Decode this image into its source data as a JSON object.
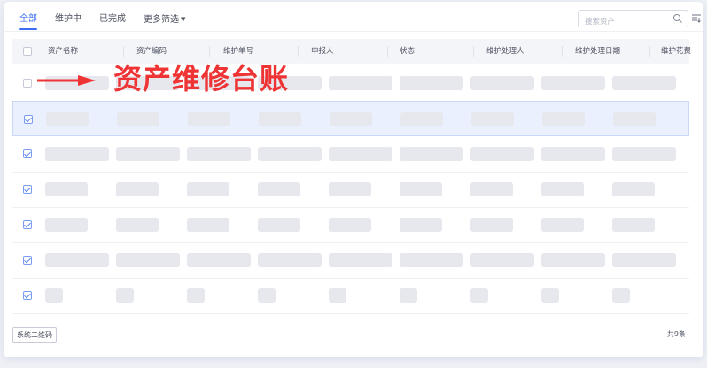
{
  "tabs": [
    {
      "label": "全部",
      "active": true
    },
    {
      "label": "维护中",
      "active": false
    },
    {
      "label": "已完成",
      "active": false
    },
    {
      "label": "更多筛选",
      "active": false,
      "has_caret": true
    }
  ],
  "search": {
    "placeholder": "搜索资产",
    "icon": "search-icon"
  },
  "filter_icon": "column-settings-icon",
  "table": {
    "columns": [
      "资产名称",
      "资产编码",
      "维护单号",
      "申报人",
      "状态",
      "维护处理人",
      "维护处理日期",
      "维护花费"
    ],
    "rows_checked": [
      false,
      true,
      true,
      true,
      true,
      true,
      true
    ],
    "selected_row": 1
  },
  "annotation": {
    "text": "资产维修台账",
    "arrow": "right-arrow-icon",
    "color": "#ee3434"
  },
  "footer": {
    "qr_button": "系统二维码",
    "total": "共9条"
  },
  "colors": {
    "accent": "#3b6cf6",
    "placeholder_bar": "#e6e8ee",
    "selected_row": "#eaf0fd"
  }
}
